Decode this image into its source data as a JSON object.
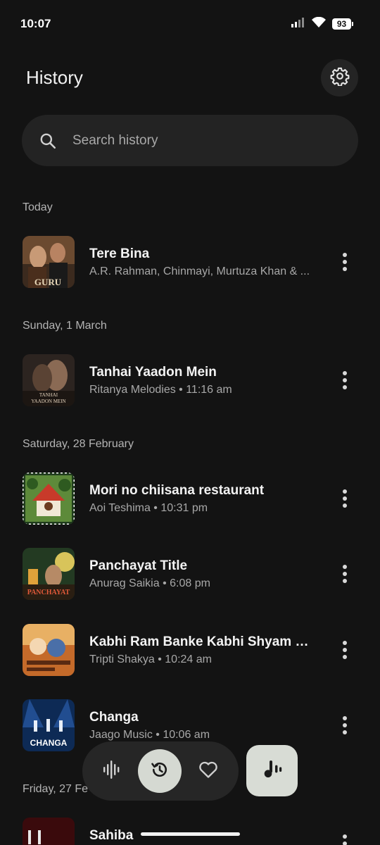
{
  "status": {
    "time": "10:07",
    "battery": "93"
  },
  "header": {
    "title": "History"
  },
  "search": {
    "placeholder": "Search history"
  },
  "sections": {
    "today": "Today",
    "sun": "Sunday, 1 March",
    "sat": "Saturday, 28 February",
    "fri": "Friday, 27 Fe"
  },
  "songs": [
    {
      "title": "Tere Bina",
      "subtitle": "A.R. Rahman, Chinmayi, Murtuza Khan & ..."
    },
    {
      "title": "Tanhai Yaadon Mein",
      "subtitle": "Ritanya Melodies • 11:16 am"
    },
    {
      "title": "Mori no chiisana restaurant",
      "subtitle": "Aoi Teshima • 10:31 pm"
    },
    {
      "title": "Panchayat Title",
      "subtitle": "Anurag Saikia • 6:08 pm"
    },
    {
      "title": "Kabhi Ram Banke Kabhi Shyam Ban...",
      "subtitle": "Tripti Shakya • 10:24 am"
    },
    {
      "title": "Changa",
      "subtitle": "Jaago Music • 10:06 am"
    },
    {
      "title": "Sahiba",
      "subtitle": ""
    }
  ],
  "artwork_text": {
    "guru": "GURU",
    "tanhai": "TANHAI",
    "yaadon": "YAADON MEIN",
    "panchayat": "PANCHAYAT",
    "changa": "CHANGA"
  },
  "colors": {
    "background": "#131313",
    "surface": "#232323",
    "accent": "#d5d9d2"
  },
  "icons": {
    "settings": "gear-icon",
    "search": "search-icon",
    "more": "more-vert-icon",
    "nav_listen": "waveform-icon",
    "nav_history": "history-icon",
    "nav_favorites": "heart-icon",
    "fab": "music-recognize-icon"
  }
}
